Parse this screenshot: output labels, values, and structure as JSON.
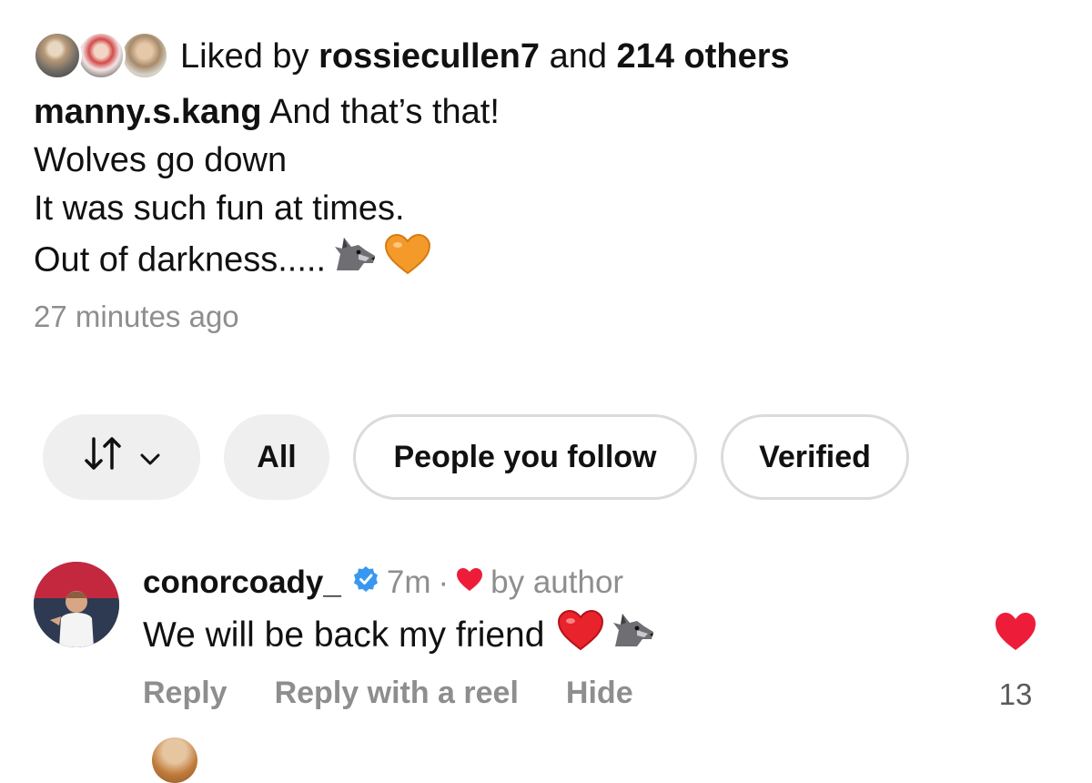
{
  "post": {
    "liked_by": {
      "prefix": "Liked by",
      "user": "rossiecullen7",
      "connector": "and",
      "others": "214 others"
    },
    "caption": {
      "username": "manny.s.kang",
      "first_line": "And that’s that!",
      "line2": "Wolves go down",
      "line3": "It was such fun at times.",
      "line4": "Out of darkness.....",
      "emojis": [
        "wolf-emoji",
        "orange-heart-emoji"
      ]
    },
    "timestamp": "27 minutes ago"
  },
  "filters": {
    "sort_icon": "sort-arrows-icon",
    "chips": [
      {
        "label": "All"
      },
      {
        "label": "People you follow"
      },
      {
        "label": "Verified"
      }
    ]
  },
  "comment": {
    "username": "conorcoady_",
    "verified": true,
    "time": "7m",
    "separator": "·",
    "liked_by_author": "by author",
    "text": "We will be back my friend",
    "text_emojis": [
      "red-heart-emoji",
      "wolf-emoji"
    ],
    "actions": {
      "reply": "Reply",
      "reply_reel": "Reply with a reel",
      "hide": "Hide"
    },
    "like_count": "13"
  },
  "colors": {
    "text": "#111111",
    "muted": "#8e8e8e",
    "verified_blue": "#3897f0",
    "like_red": "#ed1d3a",
    "chip_fill": "#efefef",
    "chip_border": "#dbdbdb"
  }
}
